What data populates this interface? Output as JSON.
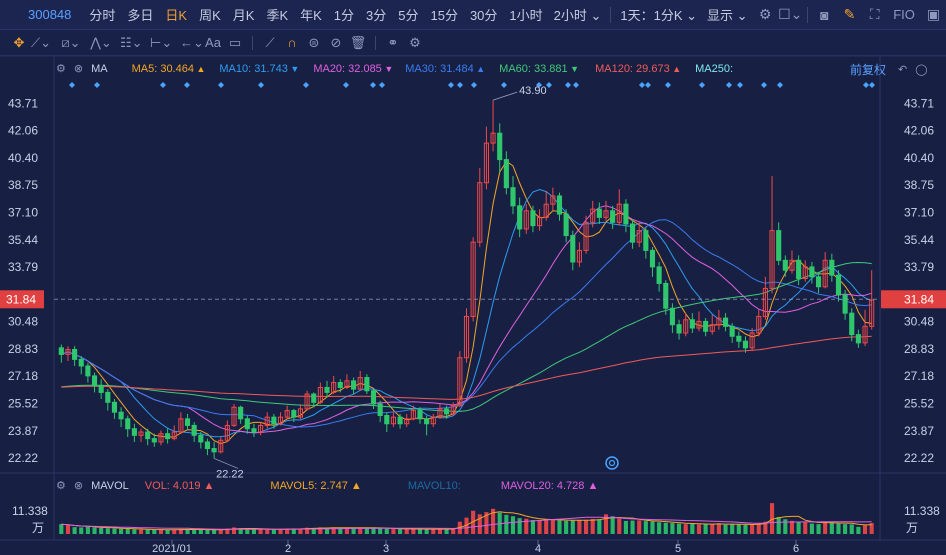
{
  "toolbar": {
    "stock_code": "300848",
    "periods": [
      {
        "label": "分时",
        "active": false
      },
      {
        "label": "多日",
        "active": false
      },
      {
        "label": "日K",
        "active": true
      },
      {
        "label": "周K",
        "active": false
      },
      {
        "label": "月K",
        "active": false
      },
      {
        "label": "季K",
        "active": false
      },
      {
        "label": "年K",
        "active": false
      },
      {
        "label": "1分",
        "active": false
      },
      {
        "label": "3分",
        "active": false
      },
      {
        "label": "5分",
        "active": false
      },
      {
        "label": "15分",
        "active": false
      },
      {
        "label": "30分",
        "active": false
      },
      {
        "label": "1小时",
        "active": false
      }
    ],
    "two_hour_label": "2小时",
    "range_label": "1天：1分K",
    "display_label": "显示",
    "fio_label": "FIO"
  },
  "ma_legend": {
    "name": "MA",
    "items": [
      {
        "label": "MA5: 30.464",
        "dir": "▲",
        "color": "#f5a623"
      },
      {
        "label": "MA10: 31.743",
        "dir": "▼",
        "color": "#2d9cf0"
      },
      {
        "label": "MA20: 32.085",
        "dir": "▼",
        "color": "#e060e0"
      },
      {
        "label": "MA30: 31.484",
        "dir": "▲",
        "color": "#3a7cf0"
      },
      {
        "label": "MA60: 33.881",
        "dir": "▼",
        "color": "#3fc87a"
      },
      {
        "label": "MA120: 29.673",
        "dir": "▲",
        "color": "#f05a5a"
      },
      {
        "label": "MA250:",
        "dir": "",
        "color": "#80e8f0"
      }
    ],
    "adjust_label": "前复权"
  },
  "price_axis": {
    "labels": [
      "43.71",
      "42.06",
      "40.40",
      "38.75",
      "37.10",
      "35.44",
      "33.79",
      "31.84",
      "30.48",
      "28.83",
      "27.18",
      "25.52",
      "23.87",
      "22.22"
    ],
    "current": "31.84"
  },
  "annotations": {
    "high": "43.90",
    "low": "22.22"
  },
  "date_axis": [
    "2021/01",
    "2",
    "3",
    "4",
    "5",
    "6"
  ],
  "volume_legend": {
    "name": "MAVOL",
    "vol": "VOL: 4.019",
    "mavol5": "MAVOL5: 2.747",
    "mavol10": "MAVOL10:",
    "mavol20": "MAVOL20: 4.728",
    "axis_top": "11.338",
    "axis_unit": "万"
  },
  "colors": {
    "up": "#f04848",
    "down": "#2ec76c",
    "bg": "#172043"
  },
  "chart_data": {
    "type": "candlestick",
    "candles": [
      [
        28.9,
        28.5,
        29.1,
        28.0
      ],
      [
        28.5,
        28.8,
        29.0,
        28.1
      ],
      [
        28.8,
        28.2,
        29.0,
        27.8
      ],
      [
        28.2,
        27.8,
        28.4,
        27.3
      ],
      [
        27.8,
        27.2,
        28.0,
        26.8
      ],
      [
        27.2,
        26.6,
        27.4,
        26.2
      ],
      [
        26.6,
        26.2,
        27.0,
        25.8
      ],
      [
        26.2,
        25.6,
        26.4,
        25.1
      ],
      [
        25.6,
        25.0,
        25.8,
        24.6
      ],
      [
        25.0,
        24.6,
        25.3,
        24.1
      ],
      [
        24.6,
        24.0,
        24.8,
        23.5
      ],
      [
        24.0,
        23.6,
        24.3,
        23.2
      ],
      [
        23.6,
        23.8,
        24.0,
        23.2
      ],
      [
        23.8,
        23.4,
        24.0,
        23.0
      ],
      [
        23.4,
        23.2,
        23.7,
        22.9
      ],
      [
        23.2,
        23.7,
        23.9,
        23.0
      ],
      [
        23.7,
        23.4,
        24.0,
        23.1
      ],
      [
        23.4,
        23.8,
        24.2,
        23.3
      ],
      [
        23.8,
        24.6,
        25.0,
        23.7
      ],
      [
        24.6,
        24.2,
        24.9,
        23.9
      ],
      [
        24.2,
        23.6,
        24.4,
        23.2
      ],
      [
        23.6,
        23.2,
        23.8,
        22.8
      ],
      [
        23.2,
        22.8,
        23.4,
        22.4
      ],
      [
        22.8,
        22.6,
        23.2,
        22.2
      ],
      [
        22.6,
        23.3,
        23.5,
        22.5
      ],
      [
        23.3,
        24.2,
        24.5,
        23.2
      ],
      [
        24.2,
        25.3,
        25.5,
        24.1
      ],
      [
        25.3,
        24.6,
        25.4,
        24.3
      ],
      [
        24.6,
        24.0,
        24.8,
        23.7
      ],
      [
        24.0,
        23.8,
        24.3,
        23.5
      ],
      [
        23.8,
        24.2,
        24.4,
        23.6
      ],
      [
        24.2,
        24.7,
        25.0,
        24.0
      ],
      [
        24.7,
        24.3,
        24.9,
        24.0
      ],
      [
        24.3,
        24.7,
        25.0,
        24.2
      ],
      [
        24.7,
        25.1,
        25.4,
        24.6
      ],
      [
        25.1,
        24.7,
        25.2,
        24.4
      ],
      [
        24.7,
        25.2,
        25.5,
        24.6
      ],
      [
        25.2,
        26.1,
        26.3,
        25.1
      ],
      [
        26.1,
        25.6,
        26.2,
        25.3
      ],
      [
        25.6,
        26.5,
        26.8,
        25.5
      ],
      [
        26.5,
        26.2,
        26.9,
        25.9
      ],
      [
        26.2,
        26.8,
        27.2,
        26.1
      ],
      [
        26.8,
        26.5,
        27.0,
        26.2
      ],
      [
        26.5,
        26.9,
        27.3,
        26.4
      ],
      [
        26.9,
        26.4,
        27.1,
        26.1
      ],
      [
        26.4,
        27.1,
        27.5,
        26.3
      ],
      [
        27.1,
        26.3,
        27.3,
        26.1
      ],
      [
        26.3,
        25.5,
        26.4,
        25.2
      ],
      [
        25.5,
        24.8,
        25.7,
        24.4
      ],
      [
        24.8,
        24.3,
        25.0,
        23.8
      ],
      [
        24.3,
        24.7,
        25.0,
        24.1
      ],
      [
        24.7,
        24.3,
        24.9,
        24.0
      ],
      [
        24.3,
        24.6,
        24.9,
        24.1
      ],
      [
        24.6,
        25.1,
        25.4,
        24.5
      ],
      [
        25.1,
        24.6,
        25.3,
        24.3
      ],
      [
        24.6,
        24.3,
        24.8,
        23.6
      ],
      [
        24.3,
        24.7,
        24.9,
        24.1
      ],
      [
        24.7,
        25.2,
        25.5,
        24.6
      ],
      [
        25.2,
        24.9,
        25.4,
        24.6
      ],
      [
        24.9,
        25.4,
        25.6,
        24.8
      ],
      [
        25.4,
        28.3,
        28.7,
        25.3
      ],
      [
        28.3,
        30.8,
        31.3,
        28.0
      ],
      [
        30.8,
        35.3,
        35.6,
        30.5
      ],
      [
        35.3,
        38.9,
        39.8,
        35.0
      ],
      [
        38.9,
        41.3,
        42.3,
        38.5
      ],
      [
        41.3,
        41.9,
        43.9,
        40.8
      ],
      [
        41.9,
        40.3,
        42.5,
        39.5
      ],
      [
        40.3,
        38.6,
        40.8,
        38.2
      ],
      [
        38.6,
        37.5,
        39.3,
        37.0
      ],
      [
        37.5,
        36.1,
        38.0,
        35.6
      ],
      [
        36.1,
        37.2,
        37.6,
        35.8
      ],
      [
        37.2,
        36.3,
        37.5,
        35.9
      ],
      [
        36.3,
        36.8,
        37.3,
        36.0
      ],
      [
        36.8,
        37.6,
        38.4,
        36.6
      ],
      [
        37.6,
        38.1,
        38.6,
        37.2
      ],
      [
        38.1,
        37.0,
        38.3,
        36.6
      ],
      [
        37.0,
        35.7,
        37.3,
        35.3
      ],
      [
        35.7,
        34.1,
        36.0,
        33.6
      ],
      [
        34.1,
        34.8,
        35.3,
        33.8
      ],
      [
        34.8,
        36.5,
        36.9,
        34.6
      ],
      [
        36.5,
        37.3,
        37.8,
        36.2
      ],
      [
        37.3,
        36.8,
        37.7,
        36.4
      ],
      [
        36.8,
        37.2,
        37.8,
        36.6
      ],
      [
        37.2,
        36.5,
        37.5,
        36.1
      ],
      [
        36.5,
        37.6,
        38.5,
        36.3
      ],
      [
        37.6,
        36.4,
        37.9,
        35.9
      ],
      [
        36.4,
        35.3,
        36.7,
        34.9
      ],
      [
        35.3,
        36.0,
        36.5,
        35.0
      ],
      [
        36.0,
        34.8,
        36.2,
        34.3
      ],
      [
        34.8,
        33.8,
        35.0,
        33.2
      ],
      [
        33.8,
        32.8,
        34.1,
        32.3
      ],
      [
        32.8,
        31.3,
        33.0,
        30.9
      ],
      [
        31.3,
        30.3,
        31.6,
        29.8
      ],
      [
        30.3,
        29.8,
        30.6,
        29.4
      ],
      [
        29.8,
        30.6,
        31.0,
        29.6
      ],
      [
        30.6,
        30.1,
        31.0,
        29.8
      ],
      [
        30.1,
        30.5,
        31.1,
        29.9
      ],
      [
        30.5,
        29.9,
        30.7,
        29.6
      ],
      [
        29.9,
        30.3,
        30.9,
        29.7
      ],
      [
        30.3,
        30.7,
        31.2,
        30.0
      ],
      [
        30.7,
        30.2,
        31.0,
        29.9
      ],
      [
        30.2,
        29.6,
        30.4,
        29.2
      ],
      [
        29.6,
        29.3,
        29.9,
        28.9
      ],
      [
        29.3,
        28.9,
        29.6,
        28.6
      ],
      [
        28.9,
        29.8,
        30.1,
        28.7
      ],
      [
        29.8,
        30.8,
        31.2,
        29.6
      ],
      [
        30.8,
        32.5,
        33.2,
        30.6
      ],
      [
        32.5,
        36.0,
        39.3,
        32.2
      ],
      [
        36.0,
        34.2,
        36.5,
        33.9
      ],
      [
        34.2,
        33.6,
        34.5,
        33.2
      ],
      [
        33.6,
        34.2,
        34.8,
        33.4
      ],
      [
        34.2,
        33.1,
        34.5,
        32.7
      ],
      [
        33.1,
        33.8,
        34.2,
        32.9
      ],
      [
        33.8,
        33.2,
        34.1,
        32.8
      ],
      [
        33.2,
        32.6,
        33.5,
        32.2
      ],
      [
        32.6,
        34.2,
        34.7,
        32.5
      ],
      [
        34.2,
        33.3,
        34.6,
        32.9
      ],
      [
        33.3,
        32.1,
        33.6,
        31.7
      ],
      [
        32.1,
        31.0,
        32.4,
        30.6
      ],
      [
        31.0,
        29.7,
        31.3,
        29.3
      ],
      [
        29.7,
        29.2,
        30.0,
        28.9
      ],
      [
        29.2,
        30.2,
        31.2,
        29.0
      ],
      [
        30.2,
        31.8,
        33.6,
        30.0
      ]
    ],
    "volume": [
      3.6,
      3.2,
      2.5,
      2.4,
      2.6,
      2.4,
      2.2,
      2.1,
      2.0,
      1.9,
      1.9,
      1.7,
      1.6,
      1.6,
      1.5,
      1.6,
      1.5,
      1.6,
      1.8,
      1.7,
      1.6,
      1.5,
      1.5,
      1.6,
      1.7,
      2.0,
      2.4,
      2.1,
      1.8,
      1.7,
      1.7,
      1.8,
      1.7,
      1.8,
      1.9,
      1.9,
      2.0,
      2.3,
      2.1,
      2.4,
      2.2,
      2.4,
      2.2,
      2.3,
      2.2,
      2.4,
      2.3,
      2.2,
      2.0,
      1.9,
      1.8,
      1.8,
      1.8,
      1.9,
      1.8,
      1.7,
      1.8,
      1.9,
      1.8,
      1.9,
      4.5,
      6.0,
      8.5,
      7.2,
      8.0,
      9.2,
      7.8,
      7.0,
      6.5,
      5.8,
      5.6,
      5.1,
      5.0,
      5.4,
      5.2,
      5.0,
      4.8,
      4.9,
      5.1,
      5.2,
      5.5,
      5.4,
      7.2,
      6.5,
      5.6,
      4.8,
      4.9,
      5.0,
      4.7,
      4.6,
      4.3,
      4.1,
      4.0,
      3.8,
      3.6,
      3.7,
      3.5,
      3.7,
      3.6,
      3.9,
      3.4,
      3.5,
      3.5,
      3.4,
      3.6,
      4.0,
      4.5,
      11.3,
      6.2,
      5.4,
      4.8,
      4.5,
      4.3,
      3.8,
      3.6,
      4.6,
      4.3,
      3.8,
      3.6,
      3.5,
      2.6,
      3.2,
      4.0
    ],
    "price_axis_range": [
      21.5,
      45.0
    ],
    "volume_max": 11.338,
    "ma_periods": [
      5,
      10,
      20,
      30,
      60,
      120
    ]
  }
}
